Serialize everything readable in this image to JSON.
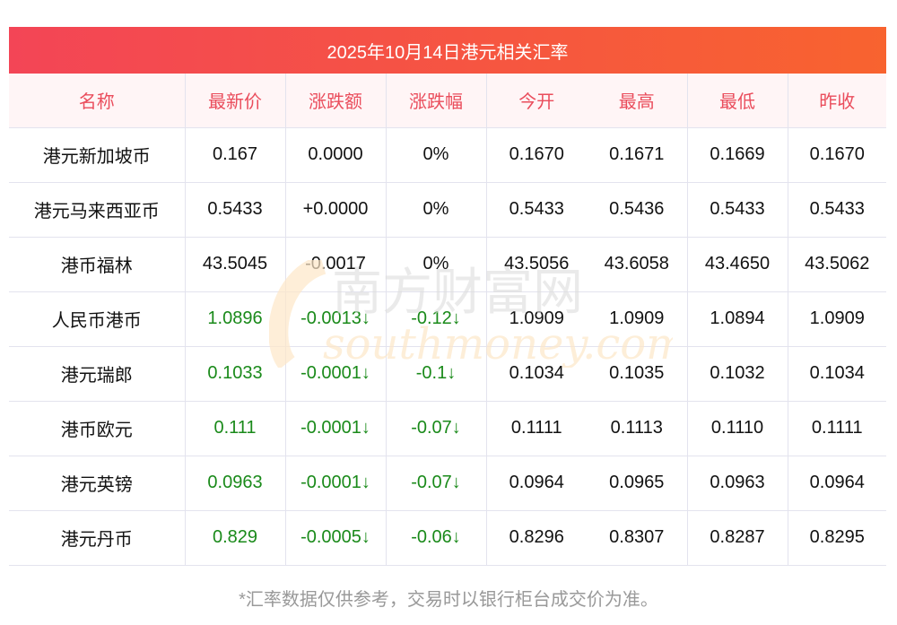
{
  "title": "2025年10月14日港元相关汇率",
  "columns": [
    "名称",
    "最新价",
    "涨跌额",
    "涨跌幅",
    "今开",
    "最高",
    "最低",
    "昨收"
  ],
  "rows": [
    {
      "name": "港元新加坡币",
      "latest": "0.167",
      "change": "0.0000",
      "pct": "0%",
      "open": "0.1670",
      "high": "0.1671",
      "low": "0.1669",
      "prev": "0.1670",
      "down": false
    },
    {
      "name": "港元马来西亚币",
      "latest": "0.5433",
      "change": "+0.0000",
      "pct": "0%",
      "open": "0.5433",
      "high": "0.5436",
      "low": "0.5433",
      "prev": "0.5433",
      "down": false
    },
    {
      "name": "港币福林",
      "latest": "43.5045",
      "change": "-0.0017",
      "pct": "0%",
      "open": "43.5056",
      "high": "43.6058",
      "low": "43.4650",
      "prev": "43.5062",
      "down": false
    },
    {
      "name": "人民币港币",
      "latest": "1.0896",
      "change": "-0.0013↓",
      "pct": "-0.12↓",
      "open": "1.0909",
      "high": "1.0909",
      "low": "1.0894",
      "prev": "1.0909",
      "down": true
    },
    {
      "name": "港元瑞郎",
      "latest": "0.1033",
      "change": "-0.0001↓",
      "pct": "-0.1↓",
      "open": "0.1034",
      "high": "0.1035",
      "low": "0.1032",
      "prev": "0.1034",
      "down": true
    },
    {
      "name": "港币欧元",
      "latest": "0.111",
      "change": "-0.0001↓",
      "pct": "-0.07↓",
      "open": "0.1111",
      "high": "0.1113",
      "low": "0.1110",
      "prev": "0.1111",
      "down": true
    },
    {
      "name": "港元英镑",
      "latest": "0.0963",
      "change": "-0.0001↓",
      "pct": "-0.07↓",
      "open": "0.0964",
      "high": "0.0965",
      "low": "0.0963",
      "prev": "0.0964",
      "down": true
    },
    {
      "name": "港元丹币",
      "latest": "0.829",
      "change": "-0.0005↓",
      "pct": "-0.06↓",
      "open": "0.8296",
      "high": "0.8307",
      "low": "0.8287",
      "prev": "0.8295",
      "down": true
    }
  ],
  "watermark": {
    "cn": "南方财富网",
    "en": "southmoney.com"
  },
  "footer": "*汇率数据仅供参考，交易时以银行柜台成交价为准。",
  "colors": {
    "down": "#1a8a1a",
    "header_text": "#ea4d5c"
  }
}
